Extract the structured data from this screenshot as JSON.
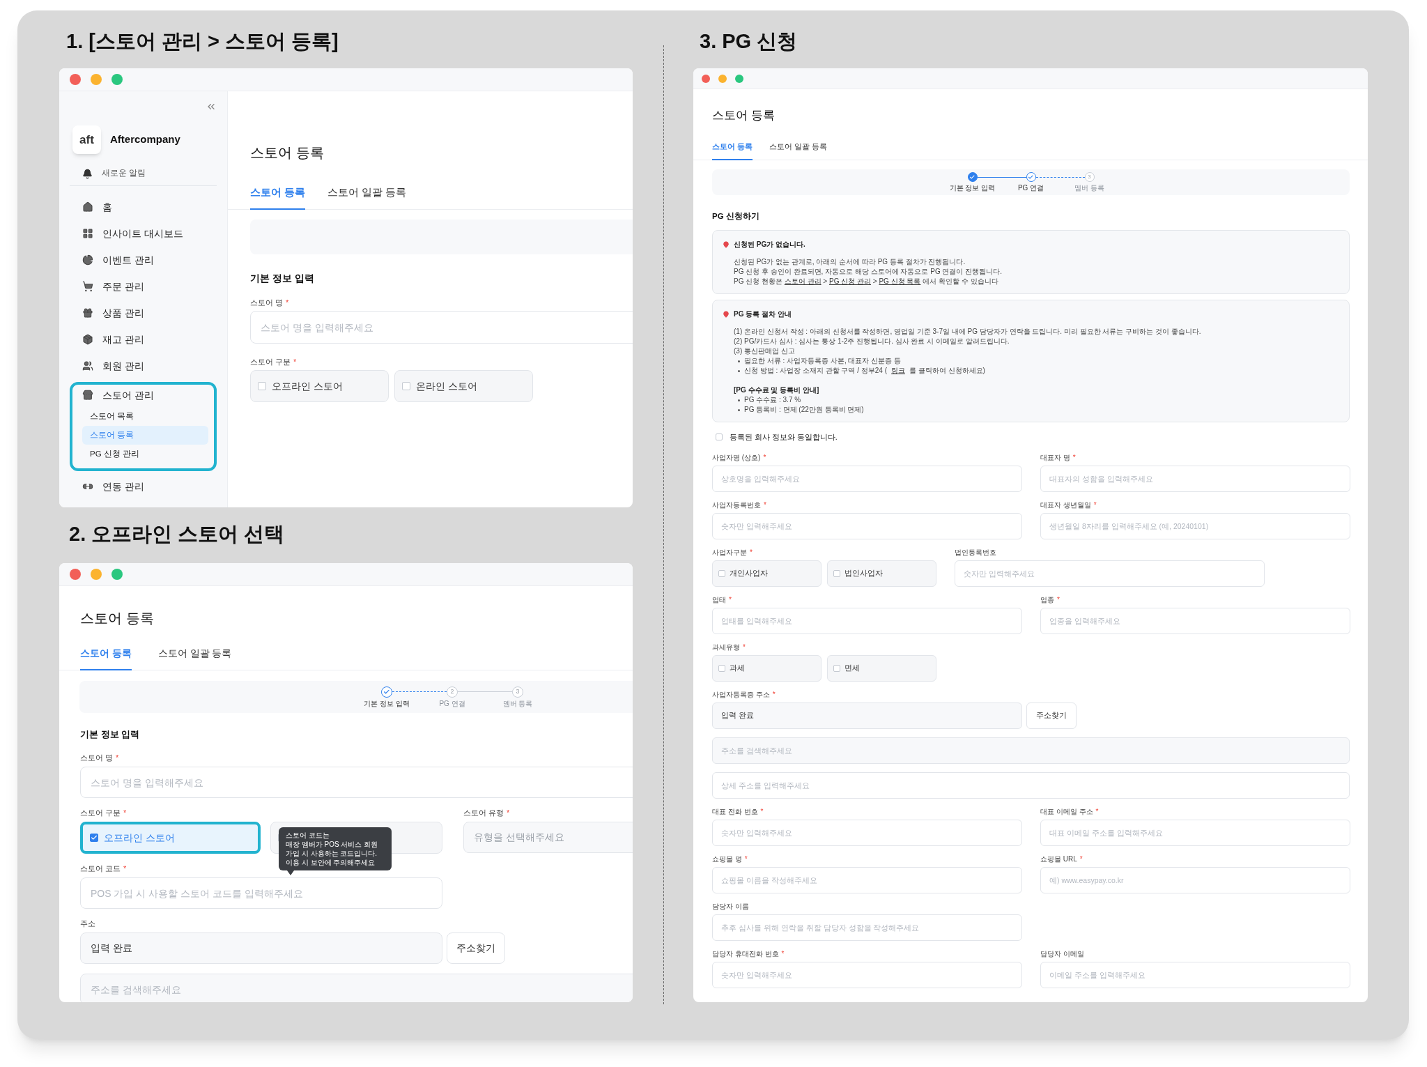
{
  "panel_1": {
    "heading": "1. [스토어 관리 > 스토어 등록]",
    "sidebar": {
      "logo_text": "aft",
      "company": "Aftercompany",
      "notification": "새로운 알림",
      "items": [
        {
          "label": "홈",
          "highlighted": false
        },
        {
          "label": "인사이트 대시보드",
          "highlighted": false
        },
        {
          "label": "이벤트 관리",
          "highlighted": false
        },
        {
          "label": "주문 관리",
          "highlighted": false
        },
        {
          "label": "상품 관리",
          "highlighted": false
        },
        {
          "label": "재고 관리",
          "highlighted": false
        },
        {
          "label": "회원 관리",
          "highlighted": false
        },
        {
          "label": "스토어 관리",
          "highlighted": true,
          "children": [
            {
              "label": "스토어 목록",
              "selected": false
            },
            {
              "label": "스토어 등록",
              "selected": true
            },
            {
              "label": "PG 신청 관리",
              "selected": false
            }
          ]
        },
        {
          "label": "연동 관리",
          "highlighted": false
        }
      ]
    },
    "page_title": "스토어 등록",
    "tabs": [
      {
        "label": "스토어 등록",
        "selected": true
      },
      {
        "label": "스토어 일괄 등록",
        "selected": false
      }
    ],
    "section_title": "기본 정보 입력",
    "rows": [
      {
        "fields": [
          {
            "kind": "wide_input",
            "label": "스토어 명",
            "mark": "*",
            "placeholder": "스토어 명을 입력해주세요"
          }
        ]
      },
      {
        "fields": [
          {
            "kind": "options",
            "label": "스토어 구분",
            "mark": "*",
            "options": [
              {
                "label": "오프라인 스토어",
                "checked": false,
                "highlighted": false
              },
              {
                "label": "온라인 스토어",
                "checked": false,
                "highlighted": false
              }
            ]
          }
        ]
      }
    ]
  },
  "panel_2": {
    "heading": "2. 오프라인 스토어 선택",
    "page_title": "스토어 등록",
    "tabs": [
      {
        "label": "스토어 등록",
        "selected": true
      },
      {
        "label": "스토어 일괄 등록",
        "selected": false
      }
    ],
    "steps": [
      {
        "kind": "active",
        "label": "기본 정보 입력"
      },
      {
        "kind": "pending",
        "label": "PG 연결",
        "number": "2"
      },
      {
        "kind": "pending",
        "label": "멤버 등록",
        "number": "3"
      }
    ],
    "section_title": "기본 정보 입력",
    "rows": [
      {
        "fields": [
          {
            "kind": "wide_input",
            "label": "스토어 명",
            "mark": "*",
            "placeholder": "스토어 명을 입력해주세요"
          }
        ]
      },
      {
        "fields": [
          {
            "kind": "options",
            "label": "스토어 구분",
            "mark": "*",
            "options": [
              {
                "label": "오프라인 스토어",
                "checked": true,
                "highlighted": true
              },
              {
                "checked": false,
                "highlighted": false
              }
            ]
          },
          {
            "kind": "select",
            "label": "스토어 유형",
            "mark": "*",
            "placeholder": "유형을 선택해주세요"
          }
        ]
      },
      {
        "fields": [
          {
            "kind": "input",
            "label": "스토어 코드",
            "mark": "*",
            "placeholder": "POS 가입 시 사용할 스토어 코드를 입력해주세요",
            "tooltip": [
              "스토어 코드는",
              "매장 멤버가 POS 서비스 회원",
              "가입 시 사용하는 코드입니다.",
              "이용 시 보안에 주의해주세요"
            ]
          }
        ]
      },
      {
        "fields": [
          {
            "kind": "address",
            "label": "주소",
            "value": "입력 완료",
            "button": "주소찾기"
          }
        ]
      },
      {
        "fields": [
          {
            "kind": "search",
            "placeholder": "주소를 검색해주세요"
          }
        ]
      }
    ]
  },
  "panel_3": {
    "heading": "3. PG 신청",
    "page_title": "스토어 등록",
    "tabs": [
      {
        "label": "스토어 등록",
        "selected": true
      },
      {
        "label": "스토어 일괄 등록",
        "selected": false
      }
    ],
    "steps": [
      {
        "kind": "done",
        "label": "기본 정보 입력"
      },
      {
        "kind": "active",
        "label": "PG 연결"
      },
      {
        "kind": "pending",
        "label": "멤버 등록",
        "number": "3"
      }
    ],
    "section_title": "PG 신청하기",
    "notices": [
      {
        "title": "신청된 PG가 없습니다.",
        "blocks": [
          {
            "kind": "text",
            "segments": [
              {
                "kind": "plain",
                "text": "신청된 PG가 없는 관계로, 아래의 순서에 따라 PG 등록 절차가 진행됩니다."
              }
            ]
          },
          {
            "kind": "text",
            "segments": [
              {
                "kind": "plain",
                "text": "PG 신청 후 승인이 완료되면, 자동으로 해당 스토어에 자동으로 PG 연결이 진행됩니다."
              }
            ]
          },
          {
            "kind": "text",
            "segments": [
              {
                "kind": "plain",
                "text": "PG 신청 현황은 "
              },
              {
                "kind": "link",
                "text": "스토어 관리"
              },
              {
                "kind": "plain",
                "text": " > "
              },
              {
                "kind": "link",
                "text": "PG 신청 관리"
              },
              {
                "kind": "plain",
                "text": " > "
              },
              {
                "kind": "link",
                "text": "PG 신청 목록"
              },
              {
                "kind": "plain",
                "text": " 에서 확인할 수 있습니다"
              }
            ]
          }
        ]
      },
      {
        "title": "PG 등록 절차 안내",
        "blocks": [
          {
            "kind": "text",
            "segments": [
              {
                "kind": "plain",
                "text": "(1) 온라인 신청서 작성 : 아래의 신청서를 작성하면, 영업일 기준 3-7일 내에 PG 담당자가 연락을 드립니다. 미리 필요한 서류는 구비하는 것이 좋습니다."
              }
            ]
          },
          {
            "kind": "text",
            "segments": [
              {
                "kind": "plain",
                "text": "(2) PG/카드사 심사 : 심사는 통상 1-2주 진행됩니다. 심사 완료 시 이메일로 알려드립니다."
              }
            ]
          },
          {
            "kind": "text",
            "segments": [
              {
                "kind": "plain",
                "text": "(3) 통신판매업 신고"
              }
            ]
          },
          {
            "kind": "bullet",
            "segments": [
              {
                "kind": "plain",
                "text": "필요한 서류 : 사업자등록증 사본, 대표자 신분증 등"
              }
            ]
          },
          {
            "kind": "bullet",
            "segments": [
              {
                "kind": "plain",
                "text": "신청 방법 : 사업장 소재지 관할 구역 / 정부24 ("
              },
              {
                "kind": "link",
                "text": "링크"
              },
              {
                "kind": "plain",
                "text": "를 클릭하여 신청하세요)"
              }
            ]
          },
          {
            "kind": "heading",
            "segments": [
              {
                "kind": "plain",
                "text": "[PG 수수료 및 등록비 안내]"
              }
            ]
          },
          {
            "kind": "bullet",
            "segments": [
              {
                "kind": "plain",
                "text": "PG 수수료 : 3.7 %"
              }
            ]
          },
          {
            "kind": "bullet",
            "segments": [
              {
                "kind": "plain",
                "text": "PG 등록비 : 면제 (22만원 등록비 면제)"
              }
            ]
          }
        ]
      }
    ],
    "agree": {
      "label": "등록된 회사 정보와 동일합니다.",
      "checked": false
    },
    "rows": [
      {
        "fields": [
          {
            "kind": "input",
            "label": "사업자명 (상호)",
            "mark": "*",
            "placeholder": "상호명을 입력해주세요"
          },
          {
            "kind": "input",
            "label": "대표자 명",
            "mark": "*",
            "placeholder": "대표자의 성함을 입력해주세요"
          }
        ]
      },
      {
        "fields": [
          {
            "kind": "input",
            "label": "사업자등록번호",
            "mark": "*",
            "placeholder": "숫자만 입력해주세요"
          },
          {
            "kind": "input",
            "label": "대표자 생년월일",
            "mark": "*",
            "placeholder": "생년월일 8자리를 입력해주세요 (예, 20240101)"
          }
        ]
      },
      {
        "fields": [
          {
            "kind": "options",
            "label": "사업자구분",
            "mark": "*",
            "options": [
              {
                "label": "개인사업자",
                "checked": false,
                "highlighted": false
              },
              {
                "label": "법인사업자",
                "checked": false,
                "highlighted": false
              }
            ]
          },
          {
            "kind": "input",
            "label": "법인등록번호",
            "placeholder": "숫자만 입력해주세요"
          }
        ]
      },
      {
        "fields": [
          {
            "kind": "input",
            "label": "업태",
            "mark": "*",
            "placeholder": "업태를 입력해주세요"
          },
          {
            "kind": "input",
            "label": "업종",
            "mark": "*",
            "placeholder": "업종을 입력해주세요"
          }
        ]
      },
      {
        "fields": [
          {
            "kind": "options",
            "label": "과세유형",
            "mark": "*",
            "options": [
              {
                "label": "과세",
                "checked": false,
                "highlighted": false
              },
              {
                "label": "면세",
                "checked": false,
                "highlighted": false
              }
            ]
          }
        ]
      },
      {
        "fields": [
          {
            "kind": "address",
            "label": "사업자등록증 주소",
            "mark": "*",
            "value": "입력 완료",
            "button": "주소찾기"
          }
        ]
      },
      {
        "fields": [
          {
            "kind": "search",
            "placeholder": "주소를 검색해주세요"
          }
        ]
      },
      {
        "fields": [
          {
            "kind": "wide_input",
            "placeholder": "상세 주소를 입력해주세요"
          }
        ]
      },
      {
        "fields": [
          {
            "kind": "input",
            "label": "대표 전화 번호",
            "mark": "*",
            "placeholder": "숫자만 입력해주세요"
          },
          {
            "kind": "input",
            "label": "대표 이메일 주소",
            "mark": "*",
            "placeholder": "대표 이메일 주소를 입력해주세요"
          }
        ]
      },
      {
        "fields": [
          {
            "kind": "input",
            "label": "쇼핑몰 명",
            "mark": "*",
            "placeholder": "쇼핑몰 이름을 작성해주세요"
          },
          {
            "kind": "input",
            "label": "쇼핑몰 URL",
            "mark": "*",
            "placeholder": "예) www.easypay.co.kr"
          }
        ]
      },
      {
        "fields": [
          {
            "kind": "input",
            "label": "담당자 이름",
            "placeholder": "추후 심사를 위해 연락을 취할 담당자 성함을 작성해주세요"
          }
        ]
      },
      {
        "fields": [
          {
            "kind": "input",
            "label": "담당자 휴대전화 번호",
            "mark": "*",
            "placeholder": "숫자만 입력해주세요"
          },
          {
            "kind": "input",
            "label": "담당자 이메일",
            "placeholder": "이메일 주소를 입력해주세요"
          }
        ]
      }
    ]
  }
}
